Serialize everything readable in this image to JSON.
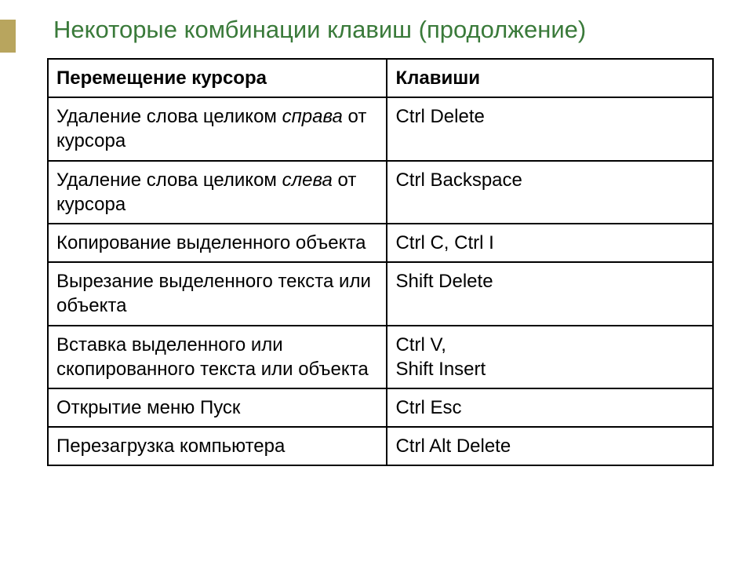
{
  "title": "Некоторые комбинации клавиш (продолжение)",
  "headers": {
    "action": "Перемещение курсора",
    "keys": "Клавиши"
  },
  "rows": [
    {
      "action_prefix": "Удаление слова целиком ",
      "action_italic": "справа",
      "action_suffix": " от курсора",
      "keys": "Ctrl   Delete"
    },
    {
      "action_prefix": "Удаление слова целиком ",
      "action_italic": "слева",
      "action_suffix": " от курсора",
      "keys": "Ctrl   Backspace"
    },
    {
      "action_prefix": "Копирование выделенного объекта",
      "action_italic": "",
      "action_suffix": "",
      "keys": "Ctrl  C,    Ctrl  I"
    },
    {
      "action_prefix": "Вырезание выделенного текста или объекта",
      "action_italic": "",
      "action_suffix": "",
      "keys": "Shift  Delete"
    },
    {
      "action_prefix": "Вставка выделенного или скопированного текста или объекта",
      "action_italic": "",
      "action_suffix": "",
      "keys_line1": "Ctrl  V,",
      "keys_line2": "Shift  Insert"
    },
    {
      "action_prefix": "Открытие меню Пуск",
      "action_italic": "",
      "action_suffix": "",
      "keys": "Ctrl  Esc"
    },
    {
      "action_prefix": "Перезагрузка компьютера",
      "action_italic": "",
      "action_suffix": "",
      "keys": "Ctrl Alt Delete"
    }
  ]
}
